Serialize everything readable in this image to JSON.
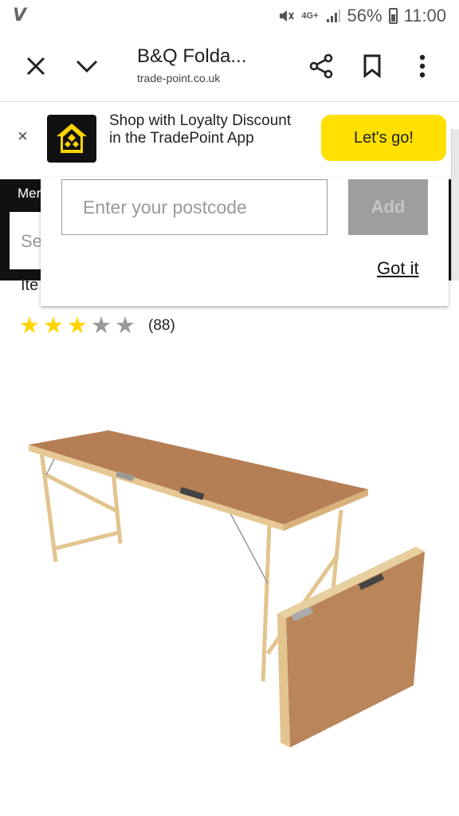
{
  "status_bar": {
    "carrier_glyph": "V",
    "network": "4G+",
    "battery": "56%",
    "time": "11:00"
  },
  "browser": {
    "title": "B&Q Folda...",
    "url": "trade-point.co.uk",
    "icons": [
      "close-icon",
      "chevron-down-icon",
      "share-icon",
      "bookmark-icon",
      "more-vert-icon"
    ]
  },
  "loyalty_banner": {
    "close": "×",
    "text": "Shop with Loyalty Discount in the TradePoint App",
    "cta": "Let's go!"
  },
  "site_header": {
    "menu_label": "Mer",
    "search_hint": "Se",
    "items_label": "Ite"
  },
  "postcode_popup": {
    "placeholder": "Enter your postcode",
    "add_label": "Add",
    "dismiss_label": "Got it"
  },
  "rating": {
    "stars": 3,
    "max": 5,
    "count": "(88)"
  },
  "colors": {
    "accent_yellow": "#ffe000",
    "star_on": "#ffd400",
    "star_off": "#999999",
    "header_dark": "#111111"
  }
}
